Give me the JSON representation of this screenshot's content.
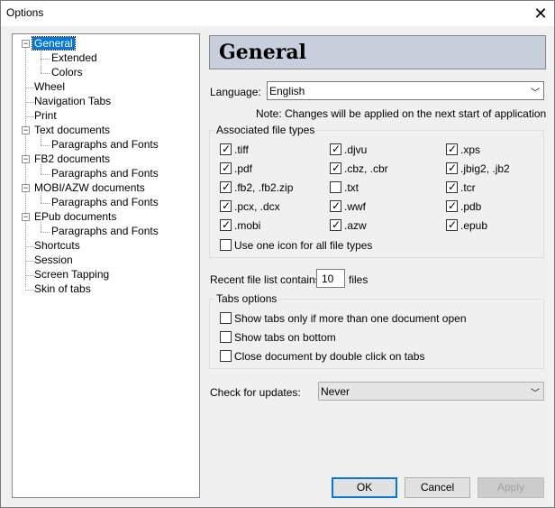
{
  "window": {
    "title": "Options",
    "close_glyph": "✕"
  },
  "tree": {
    "expander_glyph": "−",
    "items": [
      {
        "label": "General"
      },
      {
        "label": "Extended"
      },
      {
        "label": "Colors"
      },
      {
        "label": "Wheel"
      },
      {
        "label": "Navigation Tabs"
      },
      {
        "label": "Print"
      },
      {
        "label": "Text documents"
      },
      {
        "label": "Paragraphs and Fonts"
      },
      {
        "label": "FB2 documents"
      },
      {
        "label": "Paragraphs and Fonts"
      },
      {
        "label": "MOBI/AZW documents"
      },
      {
        "label": "Paragraphs and Fonts"
      },
      {
        "label": "EPub documents"
      },
      {
        "label": "Paragraphs and Fonts"
      },
      {
        "label": "Shortcuts"
      },
      {
        "label": "Session"
      },
      {
        "label": "Screen Tapping"
      },
      {
        "label": "Skin of tabs"
      }
    ]
  },
  "panel": {
    "title": "General",
    "language_label": "Language:",
    "language_value": "English",
    "note": "Note: Changes will be applied on the next start of application",
    "file_types_title": "Associated file types",
    "file_types": [
      {
        "label": ".tiff",
        "checked": true
      },
      {
        "label": ".djvu",
        "checked": true
      },
      {
        "label": ".xps",
        "checked": true
      },
      {
        "label": ".pdf",
        "checked": true
      },
      {
        "label": ".cbz, .cbr",
        "checked": true
      },
      {
        "label": ".jbig2, .jb2",
        "checked": true
      },
      {
        "label": ".fb2, .fb2.zip",
        "checked": true
      },
      {
        "label": ".txt",
        "checked": false
      },
      {
        "label": ".tcr",
        "checked": true
      },
      {
        "label": ".pcx, .dcx",
        "checked": true
      },
      {
        "label": ".wwf",
        "checked": true
      },
      {
        "label": ".pdb",
        "checked": true
      },
      {
        "label": ".mobi",
        "checked": true
      },
      {
        "label": ".azw",
        "checked": true
      },
      {
        "label": ".epub",
        "checked": true
      }
    ],
    "one_icon": {
      "label": "Use one icon for all file types",
      "checked": false
    },
    "recent_label": "Recent file list contains:",
    "recent_value": "10",
    "recent_suffix": "files",
    "tabs_title": "Tabs options",
    "tabs_options": [
      {
        "label": "Show tabs only if more than one document open",
        "checked": false
      },
      {
        "label": "Show tabs on bottom",
        "checked": false
      },
      {
        "label": "Close document by double click on tabs",
        "checked": false
      }
    ],
    "updates_label": "Check for updates:",
    "updates_value": "Never",
    "combo_arrow": "﹀",
    "check_glyph": "✓"
  },
  "buttons": {
    "ok": "OK",
    "cancel": "Cancel",
    "apply": "Apply"
  }
}
